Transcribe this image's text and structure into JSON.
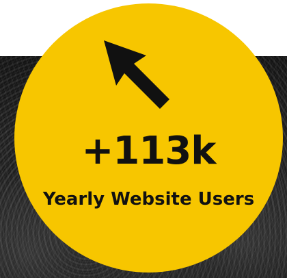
{
  "stat": {
    "value": "+113k",
    "label": "Yearly Website Users"
  },
  "icons": {
    "pointer": "mouse-cursor-icon"
  },
  "colors": {
    "accent": "#f7c600",
    "text": "#111111",
    "background_top": "#ffffff",
    "background_photo": "#1b1b1b"
  }
}
